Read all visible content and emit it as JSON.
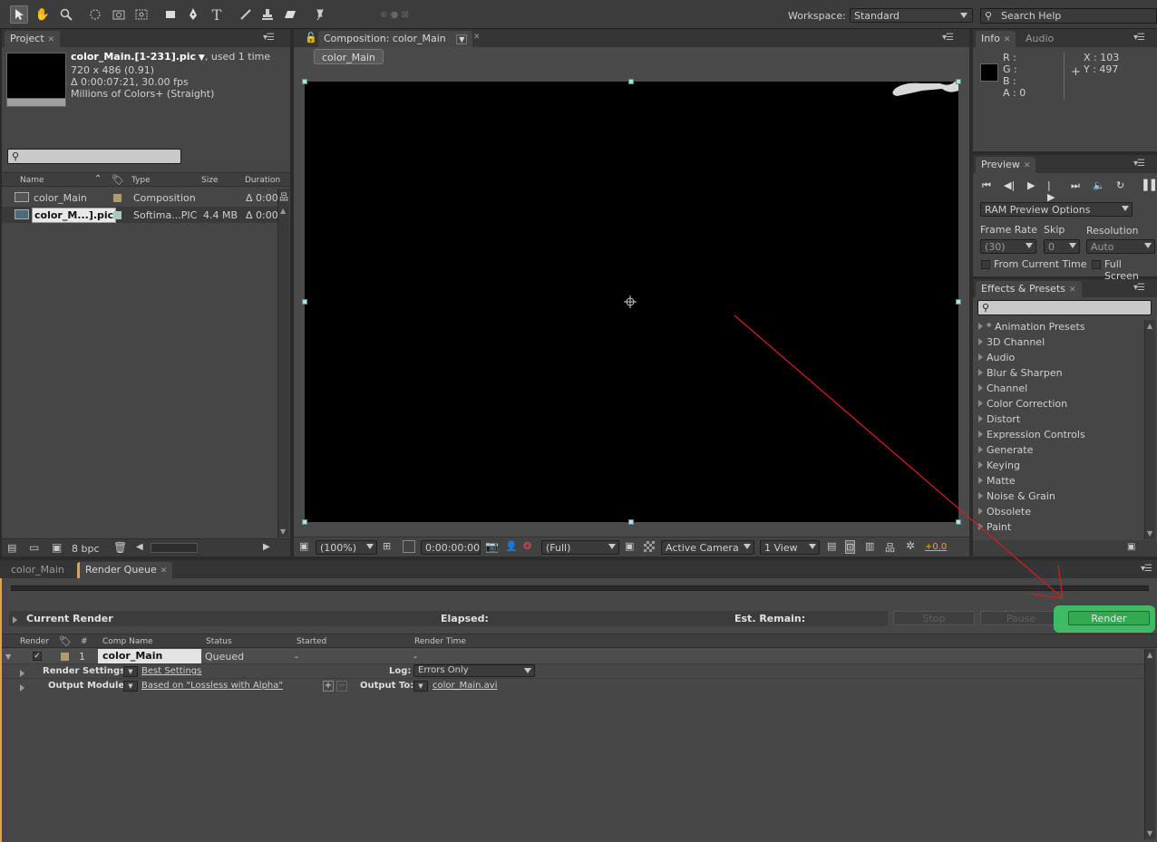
{
  "toolbar": {
    "workspace_label": "Workspace:",
    "workspace_value": "Standard",
    "search_placeholder": "Search Help",
    "tools": [
      "selection-tool-icon",
      "hand-tool-icon",
      "zoom-tool-icon",
      "rotation-tool-icon",
      "camera-orbit-tool-icon",
      "pan-behind-tool-icon",
      "rectangle-tool-icon",
      "pen-tool-icon",
      "type-tool-icon",
      "brush-tool-icon",
      "clone-stamp-tool-icon",
      "eraser-tool-icon",
      "puppet-pin-tool-icon"
    ]
  },
  "project": {
    "tab_label": "Project",
    "item_name": "color_Main.[1-231].pic",
    "used": ", used 1 time",
    "dimensions": "720 x 486 (0.91)",
    "duration": "Δ 0:00:07:21, 30.00 fps",
    "colors": "Millions of Colors+ (Straight)",
    "columns": {
      "name": "Name",
      "type": "Type",
      "size": "Size",
      "duration": "Duration"
    },
    "rows": [
      {
        "name": "color_Main",
        "type": "Composition",
        "size": "",
        "duration": "Δ 0:00",
        "label_color": "#b19a6e"
      },
      {
        "name": "color_M...].pic",
        "type": "Softima...PIC",
        "size": "4.4 MB",
        "duration": "Δ 0:00",
        "label_color": "#a8c8c0"
      }
    ],
    "bpc": "8 bpc"
  },
  "composition": {
    "tab_label": "Composition: color_Main",
    "flowchart_tab": "color_Main",
    "zoom": "(100%)",
    "timecode": "0:00:00:00",
    "resolution": "(Full)",
    "camera": "Active Camera",
    "view": "1 View",
    "exposure": "+0.0"
  },
  "info": {
    "tab_label": "Info",
    "audio_tab": "Audio",
    "r": "R :",
    "g": "G :",
    "b": "B :",
    "a": "A : 0",
    "x": "X : 103",
    "y": "Y : 497"
  },
  "preview": {
    "tab_label": "Preview",
    "ram_options": "RAM Preview Options",
    "frame_rate_label": "Frame Rate",
    "skip_label": "Skip",
    "resolution_label": "Resolution",
    "frame_rate_value": "(30)",
    "skip_value": "0",
    "resolution_value": "Auto",
    "from_current_time": "From Current Time",
    "full_screen": "Full Screen"
  },
  "effects": {
    "tab_label": "Effects & Presets",
    "items": [
      "* Animation Presets",
      "3D Channel",
      "Audio",
      "Blur & Sharpen",
      "Channel",
      "Color Correction",
      "Distort",
      "Expression Controls",
      "Generate",
      "Keying",
      "Matte",
      "Noise & Grain",
      "Obsolete",
      "Paint"
    ]
  },
  "render_queue": {
    "timeline_tab": "color_Main",
    "tab_label": "Render Queue",
    "current_render": "Current Render",
    "elapsed": "Elapsed:",
    "est_remain": "Est. Remain:",
    "stop": "Stop",
    "pause": "Pause",
    "render": "Render",
    "columns": {
      "render": "Render",
      "num": "#",
      "comp_name": "Comp Name",
      "status": "Status",
      "started": "Started",
      "render_time": "Render Time"
    },
    "item": {
      "num": "1",
      "comp_name": "color_Main",
      "status": "Queued",
      "started": "-",
      "render_time": "-",
      "render_settings_label": "Render Settings:",
      "render_settings_value": "Best Settings",
      "log_label": "Log:",
      "log_value": "Errors Only",
      "output_module_label": "Output Module:",
      "output_module_value": "Based on \"Lossless with Alpha\"",
      "output_to_label": "Output To:",
      "output_to_value": "color_Main.avi"
    }
  },
  "colors": {
    "accent_yellow": "#e0a636",
    "render_highlight": "#3fcf6a",
    "annotation_arrow": "#cc2020"
  }
}
